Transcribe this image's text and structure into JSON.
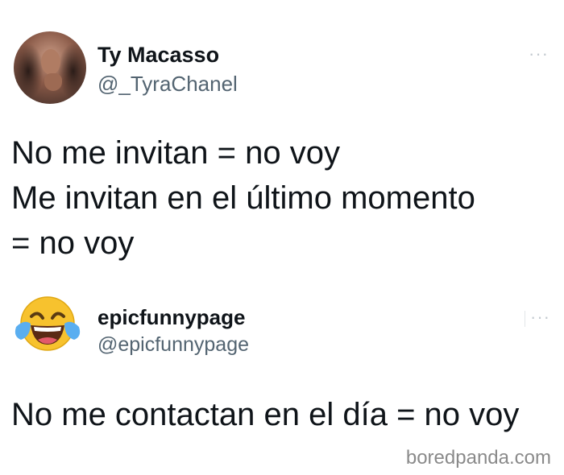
{
  "tweet1": {
    "name": "Ty Macasso",
    "handle": "@_TyraChanel",
    "avatar": "profile-photo",
    "lines": [
      "No me invitan = no voy",
      "Me invitan en el último momento",
      "= no voy"
    ]
  },
  "tweet2": {
    "name": "epicfunnypage",
    "handle": "@epicfunnypage",
    "avatar": "laughing-crying-emoji-icon",
    "text": "No me contactan en el día = no voy"
  },
  "more_icon": "more-horizontal-icon",
  "watermark": "boredpanda.com",
  "colors": {
    "text": "#0f1419",
    "handle": "#536471",
    "emoji_face": "#f7c22e",
    "emoji_tears": "#5aaef0"
  }
}
